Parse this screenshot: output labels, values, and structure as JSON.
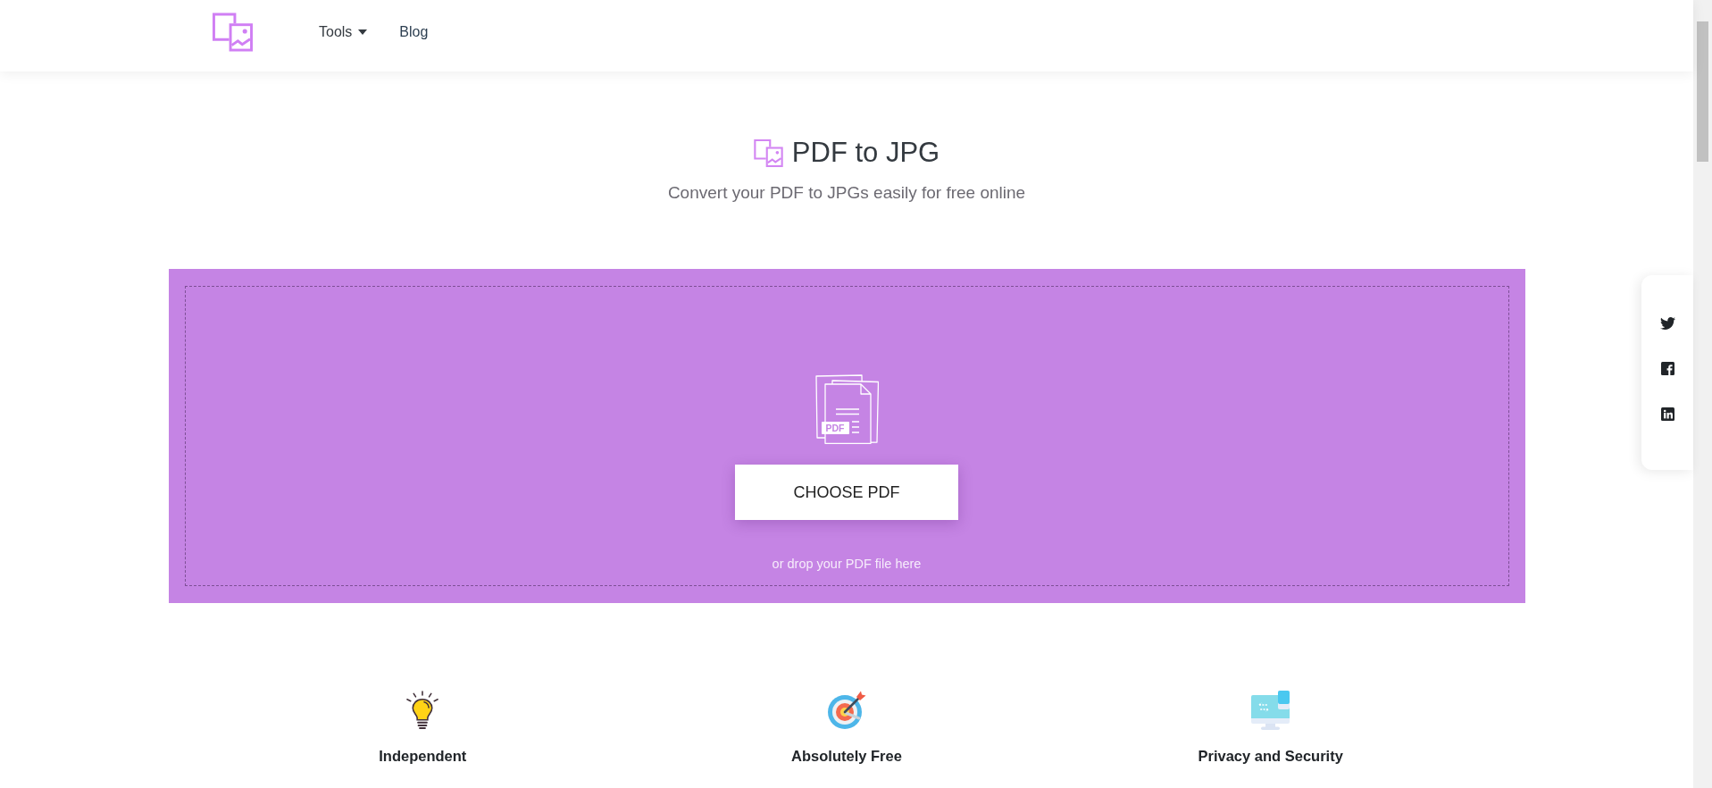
{
  "header": {
    "nav": [
      {
        "label": "Tools",
        "kind": "dropdown"
      },
      {
        "label": "Blog",
        "kind": "link"
      }
    ]
  },
  "hero": {
    "title": "PDF to JPG",
    "subtitle": "Convert your PDF to JPGs easily for free online"
  },
  "upload": {
    "icon_label": "PDF",
    "button": "CHOOSE PDF",
    "hint": "or drop your PDF file here"
  },
  "features": [
    {
      "title": "Independent"
    },
    {
      "title": "Absolutely Free"
    },
    {
      "title": "Privacy and Security"
    }
  ]
}
